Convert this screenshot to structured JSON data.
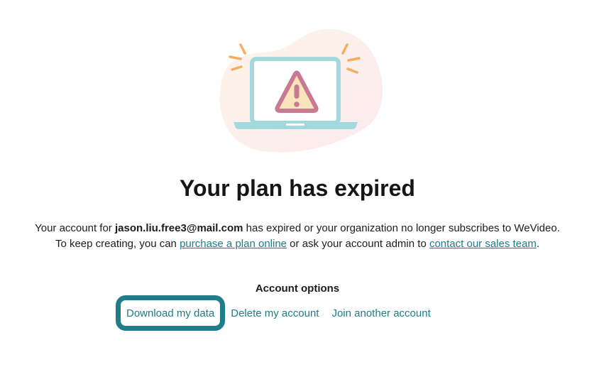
{
  "heading": "Your plan has expired",
  "message": {
    "line1_prefix": "Your account for ",
    "email": "jason.liu.free3@mail.com",
    "line1_suffix": " has expired or your organization no longer subscribes to WeVideo.",
    "line2_prefix": "To keep creating, you can ",
    "purchase_link": "purchase a plan online",
    "line2_middle": " or ask your account admin to ",
    "sales_link": "contact our sales team",
    "line2_suffix": "."
  },
  "account_options": {
    "heading": "Account options",
    "download": "Download my data",
    "delete": "Delete my account",
    "join": "Join another account"
  },
  "colors": {
    "link": "#1e7c87",
    "focus_ring": "#1f7d8a",
    "laptop": "#a3d8dd",
    "warning_fill": "#fbe4bb",
    "warning_stroke": "#c97a93",
    "blob": "#fbe9ea",
    "sparks": "#f6b36a"
  },
  "illustration": {
    "icon": "laptop-warning-icon"
  }
}
